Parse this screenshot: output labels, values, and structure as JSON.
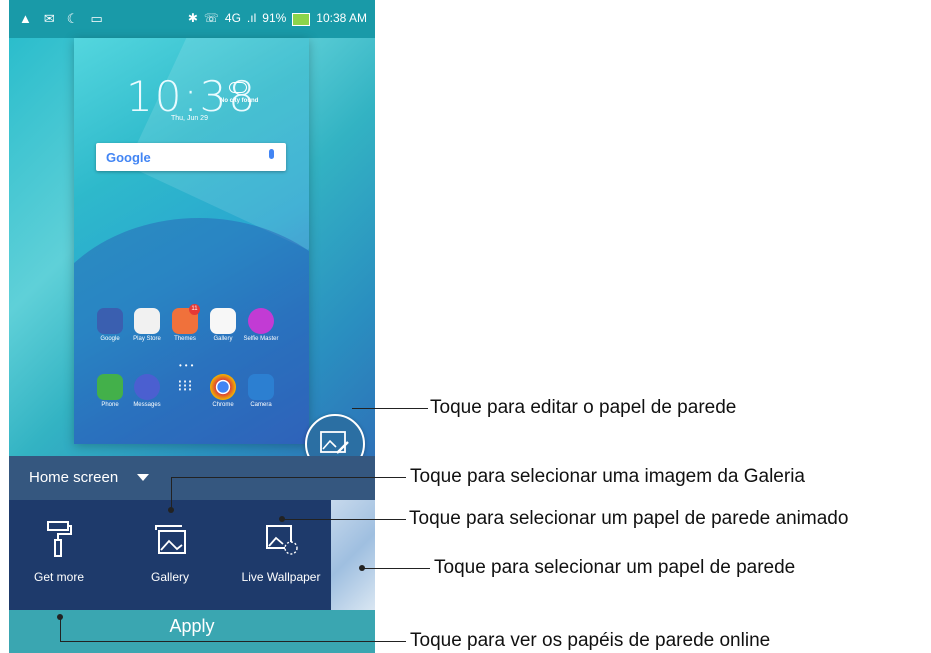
{
  "status_bar": {
    "left_icons": [
      "notification-icon",
      "email-icon",
      "moon-icon",
      "sd-card-icon"
    ],
    "bluetooth": "✱",
    "network": "4G",
    "battery": "91%",
    "time": "10:38 AM"
  },
  "lockscreen_preview": {
    "clock": "10:38",
    "weather": "No city found",
    "date": "Thu, Jun 29",
    "search_brand": "Google"
  },
  "apps_row1": [
    {
      "label": "Google",
      "color": "#3a5fb0"
    },
    {
      "label": "Play Store",
      "color": "#f1f1f1"
    },
    {
      "label": "Themes",
      "color": "#f0713b",
      "badge": "11"
    },
    {
      "label": "Gallery",
      "color": "#f7f7f7"
    },
    {
      "label": "Selfie Master",
      "color": "#c23bd4"
    }
  ],
  "apps_row2": [
    {
      "label": "Phone",
      "color": "#43b04a"
    },
    {
      "label": "Messages",
      "color": "#4b5fd0"
    },
    {
      "label": "",
      "color": "transparent"
    },
    {
      "label": "Chrome",
      "color": "#ffffff"
    },
    {
      "label": "Camera",
      "color": "#2c7fd1"
    }
  ],
  "home_selector": {
    "label": "Home screen"
  },
  "tray": {
    "get_more": "Get more",
    "gallery": "Gallery",
    "live_wallpaper": "Live Wallpaper"
  },
  "apply_button": "Apply",
  "callouts": {
    "edit": "Toque para editar o papel de parede",
    "gallery": "Toque para selecionar uma imagem da Galeria",
    "live": "Toque para selecionar um papel de parede animado",
    "wallpaper": "Toque para selecionar um papel de parede",
    "online": "Toque para ver os papéis de parede online"
  }
}
